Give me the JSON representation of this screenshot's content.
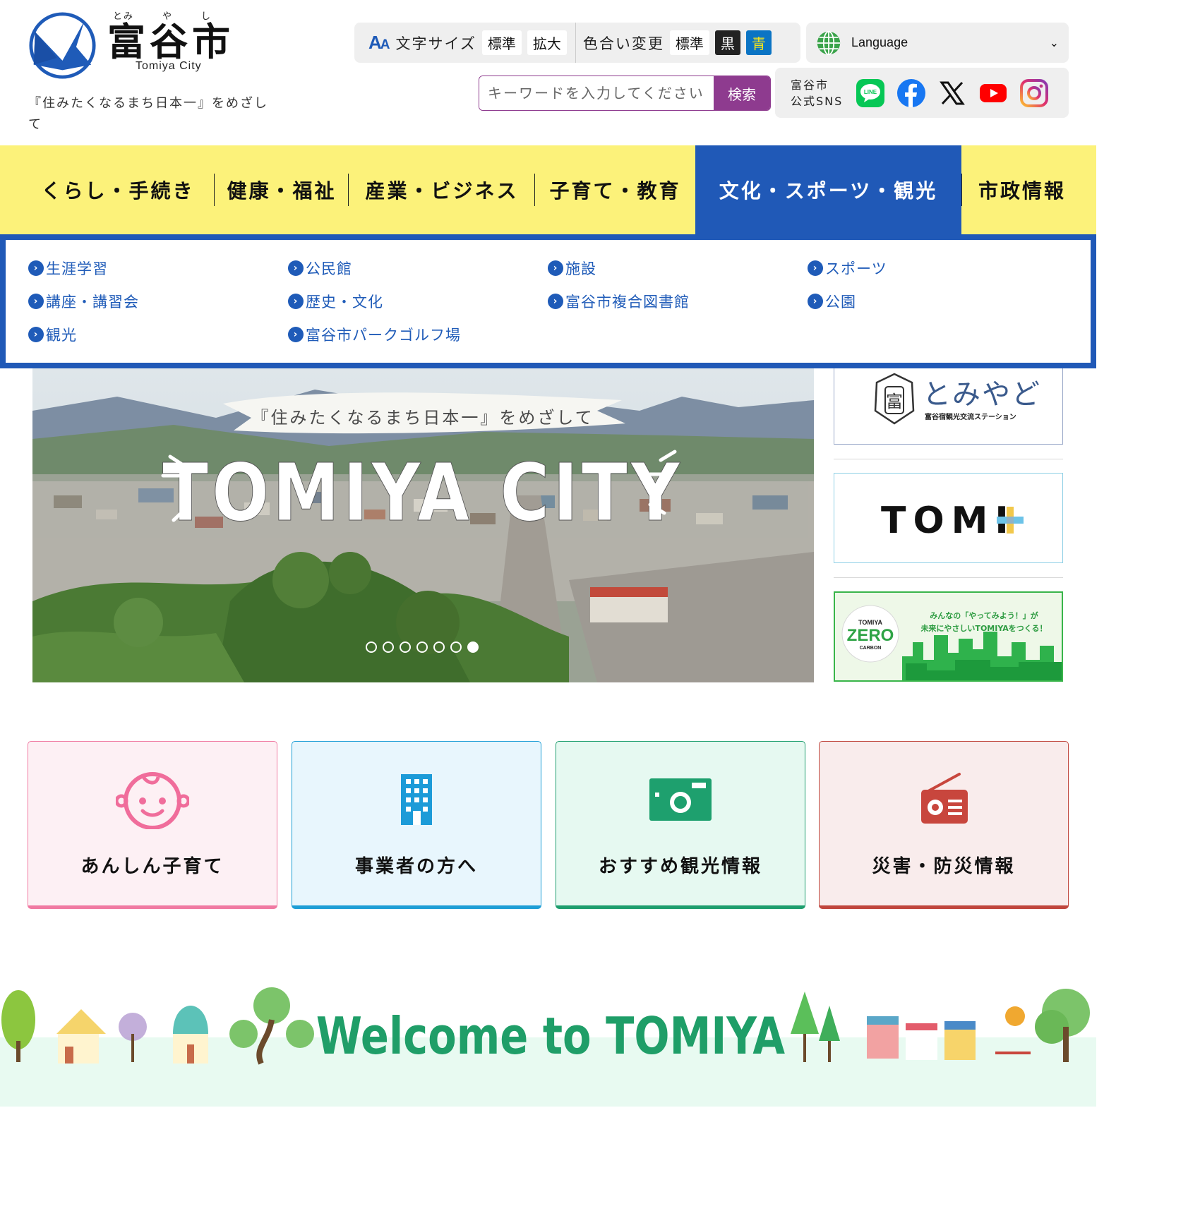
{
  "header": {
    "logo_ruby": [
      "とみ",
      "や",
      "し"
    ],
    "logo_name": "富谷市",
    "logo_en": "Tomiya City",
    "tagline": "『住みたくなるまち日本一』をめざして"
  },
  "utility": {
    "font_size_label": "文字サイズ",
    "font_standard": "標準",
    "font_large": "拡大",
    "color_label": "色合い変更",
    "color_standard": "標準",
    "color_black": "黒",
    "color_blue": "青",
    "language": "Language"
  },
  "search": {
    "placeholder": "キーワードを入力してください",
    "button": "検索"
  },
  "sns": {
    "label_line1": "富谷市",
    "label_line2": "公式SNS",
    "icons": [
      "line-icon",
      "facebook-icon",
      "x-icon",
      "youtube-icon",
      "instagram-icon"
    ]
  },
  "nav": {
    "items": [
      {
        "label": "くらし・手続き"
      },
      {
        "label": "健康・福祉"
      },
      {
        "label": "産業・ビジネス"
      },
      {
        "label": "子育て・教育"
      },
      {
        "label": "文化・スポーツ・観光",
        "active": true
      },
      {
        "label": "市政情報"
      }
    ]
  },
  "submenu": {
    "links": [
      "生涯学習",
      "公民館",
      "施設",
      "スポーツ",
      "講座・講習会",
      "歴史・文化",
      "富谷市複合図書館",
      "公園",
      "観光",
      "富谷市パークゴルフ場"
    ]
  },
  "hero": {
    "ribbon": "『住みたくなるまち日本一』をめざして",
    "title": "TOMIYA CITY",
    "slide_count": 7,
    "active_slide": 7
  },
  "banners": {
    "tomiyado_title": "とみやど",
    "tomiyado_sub": "富谷宿観光交流ステーション",
    "tomi_plus": "TOMI",
    "zero_top": "TOMIYA",
    "zero_main": "ZERO",
    "zero_bottom": "CARBON",
    "zero_line1": "みんなの「やってみよう！」が",
    "zero_line2": "未来にやさしいTOMIYAをつくる！"
  },
  "cards": [
    {
      "label": "あんしん子育て",
      "bg": "#fdf0f4",
      "border": "#f07aa2"
    },
    {
      "label": "事業者の方へ",
      "bg": "#e8f6fd",
      "border": "#1e9ed6"
    },
    {
      "label": "おすすめ観光情報",
      "bg": "#e6f9f1",
      "border": "#1e9e6e"
    },
    {
      "label": "災害・防災情報",
      "bg": "#f9ecec",
      "border": "#c0463d"
    }
  ],
  "welcome": {
    "text": "Welcome to TOMIYA"
  },
  "colors": {
    "nav_bg": "#fcf27a",
    "nav_active": "#2059b7",
    "search_accent": "#8e3b8f",
    "link_blue": "#1f5bb8"
  }
}
